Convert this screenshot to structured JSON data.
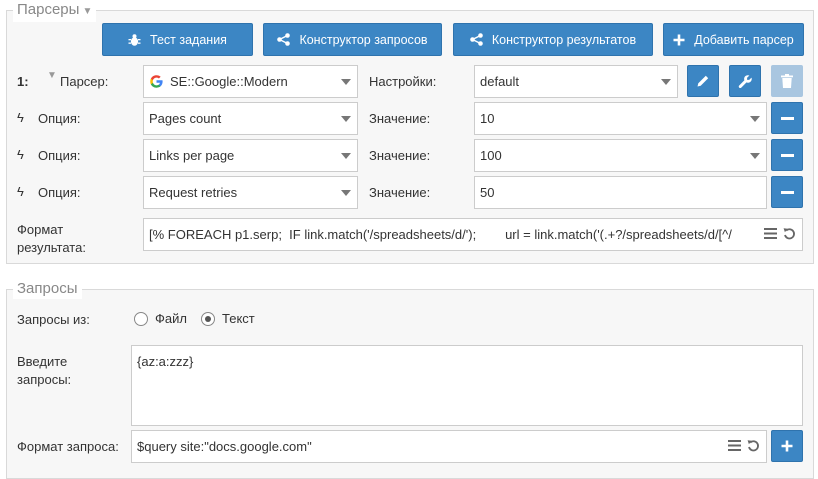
{
  "parsers_panel": {
    "legend": "Парсеры",
    "toolbar": {
      "test_task": "Тест задания",
      "query_builder": "Конструктор запросов",
      "result_builder": "Конструктор результатов",
      "add_parser": "Добавить парсер"
    },
    "parser_row": {
      "index": "1:",
      "label": "Парсер:",
      "value": "SE::Google::Modern",
      "settings_label": "Настройки:",
      "settings_value": "default"
    },
    "options": [
      {
        "label": "Опция:",
        "name": "Pages count",
        "value_label": "Значение:",
        "value": "10",
        "has_dropdown": true
      },
      {
        "label": "Опция:",
        "name": "Links per page",
        "value_label": "Значение:",
        "value": "100",
        "has_dropdown": true
      },
      {
        "label": "Опция:",
        "name": "Request retries",
        "value_label": "Значение:",
        "value": "50",
        "has_dropdown": false
      }
    ],
    "result_format": {
      "label_line1": "Формат",
      "label_line2": "результата:",
      "value": "[% FOREACH p1.serp;  IF link.match('/spreadsheets/d/');        url = link.match('(.+?/spreadsheets/d/[^/"
    }
  },
  "queries_panel": {
    "legend": "Запросы",
    "source_label": "Запросы из:",
    "source_options": [
      {
        "label": "Файл",
        "selected": false
      },
      {
        "label": "Текст",
        "selected": true
      }
    ],
    "enter_label_line1": "Введите",
    "enter_label_line2": "запросы:",
    "queries_text": "{az:a:zzz}",
    "format_label": "Формат запроса:",
    "format_value": "$query site:\"docs.google.com\""
  },
  "colors": {
    "primary": "#3c86c4",
    "disabled": "#a9c6e0"
  },
  "icons": [
    "bug-icon",
    "share-icon",
    "plus-icon",
    "google-icon",
    "pencil-icon",
    "wrench-icon",
    "trash-icon",
    "minus-icon",
    "bolt-icon",
    "list-icon",
    "undo-icon"
  ]
}
